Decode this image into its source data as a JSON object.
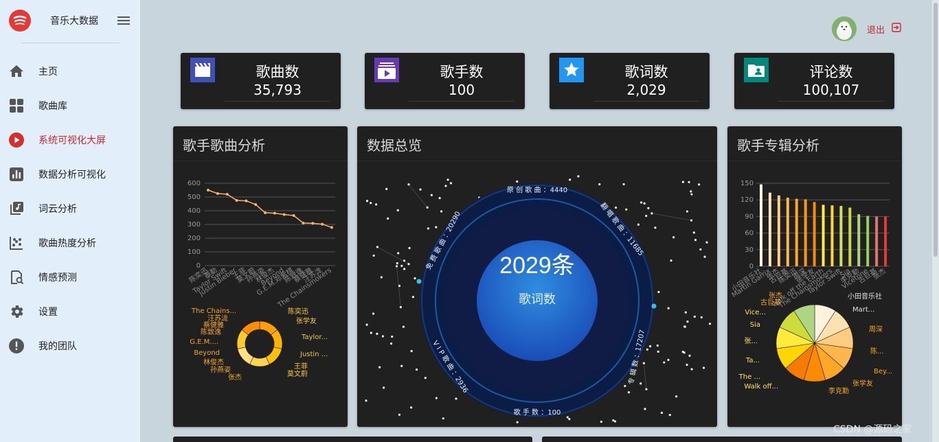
{
  "app": {
    "title": "音乐大数据"
  },
  "sidebar": {
    "items": [
      {
        "label": "主页",
        "icon": "home-icon"
      },
      {
        "label": "歌曲库",
        "icon": "grid-icon"
      },
      {
        "label": "系统可视化大屏",
        "icon": "play-circle-icon",
        "active": true
      },
      {
        "label": "数据分析可视化",
        "icon": "bar-chart-icon"
      },
      {
        "label": "词云分析",
        "icon": "library-music-icon"
      },
      {
        "label": "歌曲热度分析",
        "icon": "scatter-icon"
      },
      {
        "label": "情感预测",
        "icon": "search-doc-icon"
      },
      {
        "label": "设置",
        "icon": "gear-icon"
      },
      {
        "label": "我的团队",
        "icon": "alert-icon"
      }
    ]
  },
  "header": {
    "logout_label": "退出"
  },
  "stats": [
    {
      "label": "歌曲数",
      "value": "35,793",
      "color": "#3f51b5",
      "icon": "movie-icon"
    },
    {
      "label": "歌手数",
      "value": "100",
      "color": "#673ab7",
      "icon": "video-library-icon"
    },
    {
      "label": "歌词数",
      "value": "2,029",
      "color": "#2196f3",
      "icon": "star-icon"
    },
    {
      "label": "评论数",
      "value": "100,107",
      "color": "#00897b",
      "icon": "contact-folder-icon"
    }
  ],
  "panels": {
    "left_title": "歌手歌曲分析",
    "center_title": "数据总览",
    "right_title": "歌手专辑分析"
  },
  "chart_data": [
    {
      "type": "line",
      "yticks": [
        "0",
        "100",
        "200",
        "300",
        "400",
        "500",
        "600"
      ],
      "ylim": [
        0,
        600
      ],
      "categories": [
        "陈奕迅",
        "泰勒",
        "Taylor Swift",
        "Justin Bieber",
        "王菲",
        "莫文蔚",
        "孙燕姿",
        "林俊杰",
        "Beyond",
        "G.E.M.邓紫棋",
        "陈致逸",
        "蔡健雅",
        "汪苏泷",
        "The Chainsmokers"
      ],
      "values": [
        550,
        525,
        520,
        475,
        472,
        445,
        385,
        382,
        372,
        365,
        310,
        308,
        302,
        278
      ],
      "color": "#f6b26b"
    },
    {
      "type": "pie",
      "labels_left": [
        "The Chains...",
        "汪苏泷",
        "蔡健雅",
        "陈致逸",
        "G.E.M....",
        "Beyond",
        "林俊杰",
        "孙燕姿",
        "张杰"
      ],
      "labels_right": [
        "陈奕迅",
        "张学友",
        "Taylor...",
        "Justin ...",
        "王菲",
        "莫文蔚"
      ],
      "colors": [
        "#ffa000",
        "#ffb300",
        "#ffc107",
        "#ffd54f",
        "#ffe082",
        "#ffca28",
        "#ff8f00"
      ]
    },
    {
      "type": "bar",
      "yticks": [
        "0",
        "30",
        "60",
        "90",
        "120",
        "150"
      ],
      "ylim": [
        0,
        150
      ],
      "categories": [
        "小田音乐社",
        "Martin Garrix",
        "张杰",
        "古巨基",
        "陈奕迅",
        "周深",
        "张学友",
        "Walk off the Earth",
        "The Chainsmokers",
        "Taylor Swift",
        "Sia",
        "李克勤",
        "Vicetone",
        "古巨基",
        "张杰"
      ],
      "values": [
        148,
        133,
        128,
        124,
        122,
        121,
        116,
        111,
        110,
        109,
        106,
        94,
        91,
        90,
        90
      ],
      "colors": [
        "#fff3e0",
        "#ffe0b2",
        "#ffcc80",
        "#ffb74d",
        "#ffa726",
        "#ff9800",
        "#fb8c00",
        "#ffeb3b",
        "#fdd835",
        "#d4e157",
        "#cddc39",
        "#aed581",
        "#9ccc65",
        "#e57373",
        "#e53935"
      ]
    },
    {
      "type": "pie",
      "labels_right": [
        "小田音乐社",
        "Mart...",
        "周深",
        "陈...",
        "Bey...",
        "张学友",
        "李克勤"
      ],
      "labels_left": [
        "张杰",
        "古巨基",
        "Vice...",
        "Sia",
        "张...",
        "Ta...",
        "The ...",
        "Walk off..."
      ],
      "colors": [
        "#fff3e0",
        "#ffe0b2",
        "#ffcc80",
        "#ffb74d",
        "#ffa726",
        "#fb8c00",
        "#f57c00",
        "#ffd600",
        "#ffeb3b",
        "#cddc39",
        "#aed581"
      ]
    }
  ],
  "overview": {
    "center_value": "2029条",
    "center_label": "歌词数",
    "ring_labels": {
      "top": "原 创 歌 曲 ：4440",
      "top_right": "翻 唱 歌 曲 ：11685",
      "right": "专 辑 数 ：17207",
      "bottom": "歌 手 数 ：100",
      "bottom_left": "V I P 歌 曲 ：2936",
      "left": "免 费 歌 曲 ：20290"
    }
  },
  "watermark": "CSDN @源码之家"
}
